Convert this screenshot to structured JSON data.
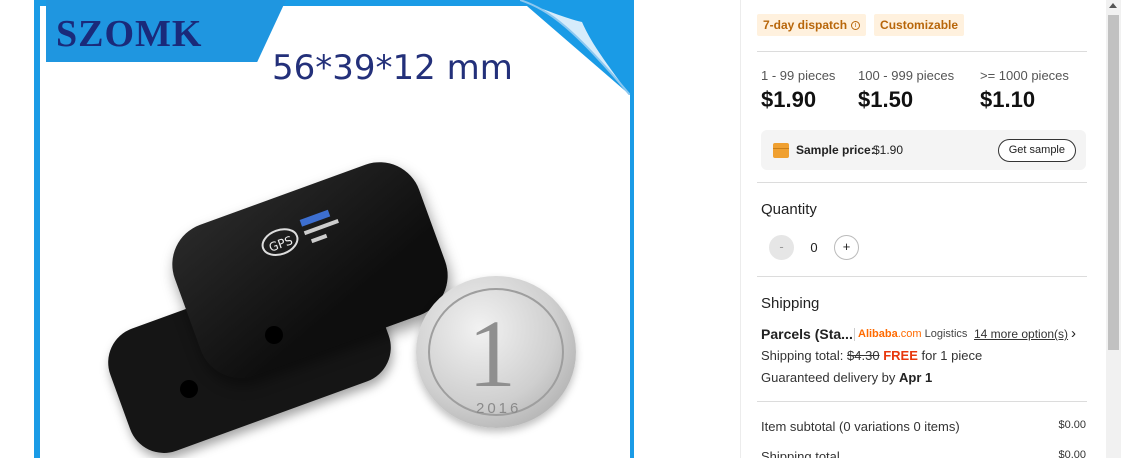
{
  "product_image": {
    "brand": "SZOMK",
    "dimensions": "56*39*12 mm",
    "coin_digit": "1",
    "coin_year": "2016"
  },
  "badges": [
    {
      "label": "7-day dispatch",
      "icon": "info-icon"
    },
    {
      "label": "Customizable"
    }
  ],
  "price_tiers": [
    {
      "range": "1 - 99 pieces",
      "price": "$1.90"
    },
    {
      "range": "100 - 999 pieces",
      "price": "$1.50"
    },
    {
      "range": ">= 1000 pieces",
      "price": "$1.10"
    }
  ],
  "sample": {
    "icon": "box-icon",
    "label": "Sample price:",
    "value": "$1.90",
    "button_label": "Get sample"
  },
  "quantity": {
    "title": "Quantity",
    "value": "0",
    "minus": "-",
    "plus": "+"
  },
  "shipping": {
    "title": "Shipping",
    "method": "Parcels (Sta...",
    "carrier_part1": "Alibaba",
    "carrier_part2": ".com",
    "carrier_part3": " Logistics",
    "more_options": "14 more option(s)",
    "more_arrow": "›",
    "total_label": "Shipping total:",
    "old_price": "$4.30",
    "free_label": "FREE",
    "per_piece": "for 1 piece",
    "guarantee_label": "Guaranteed delivery by",
    "guarantee_date": "Apr 1"
  },
  "summary": [
    {
      "label": "Item subtotal (0 variations 0 items)",
      "amount": "$0.00"
    },
    {
      "label": "Shipping total",
      "amount": "$0.00"
    }
  ],
  "colors": {
    "accent_orange": "#ff6a00",
    "free_red": "#e8380d",
    "badge_bg": "#fff1de",
    "badge_text": "#b8660a",
    "image_blue": "#1a9be6"
  }
}
